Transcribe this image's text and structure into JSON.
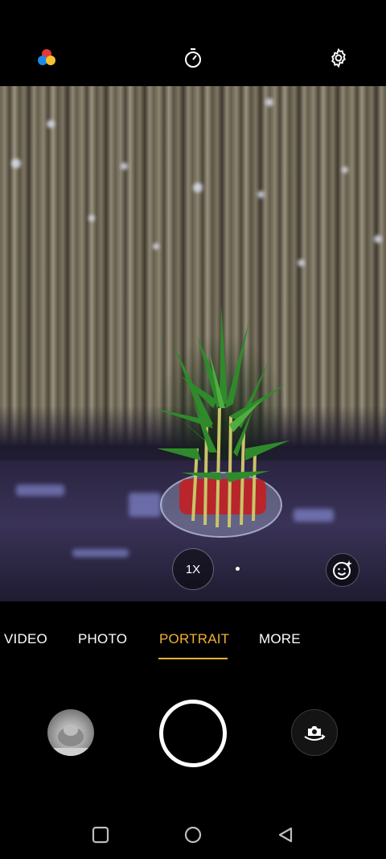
{
  "top_bar": {
    "icons": [
      "color-filter-icon",
      "timer-icon",
      "settings-gear-icon"
    ]
  },
  "viewfinder": {
    "zoom_label": "1X",
    "beauty_icon": "face-beauty-icon"
  },
  "modes": {
    "items": [
      {
        "label": "VIDEO",
        "active": false
      },
      {
        "label": "PHOTO",
        "active": false
      },
      {
        "label": "PORTRAIT",
        "active": true
      },
      {
        "label": "MORE",
        "active": false
      }
    ]
  },
  "controls": {
    "gallery_icon": "gallery-thumbnail",
    "shutter_icon": "shutter-button",
    "flip_icon": "camera-switch-icon"
  },
  "navbar": {
    "icons": [
      "recents-square-icon",
      "home-circle-icon",
      "back-triangle-icon"
    ]
  },
  "colors": {
    "accent": "#f2b134",
    "background": "#000000"
  }
}
